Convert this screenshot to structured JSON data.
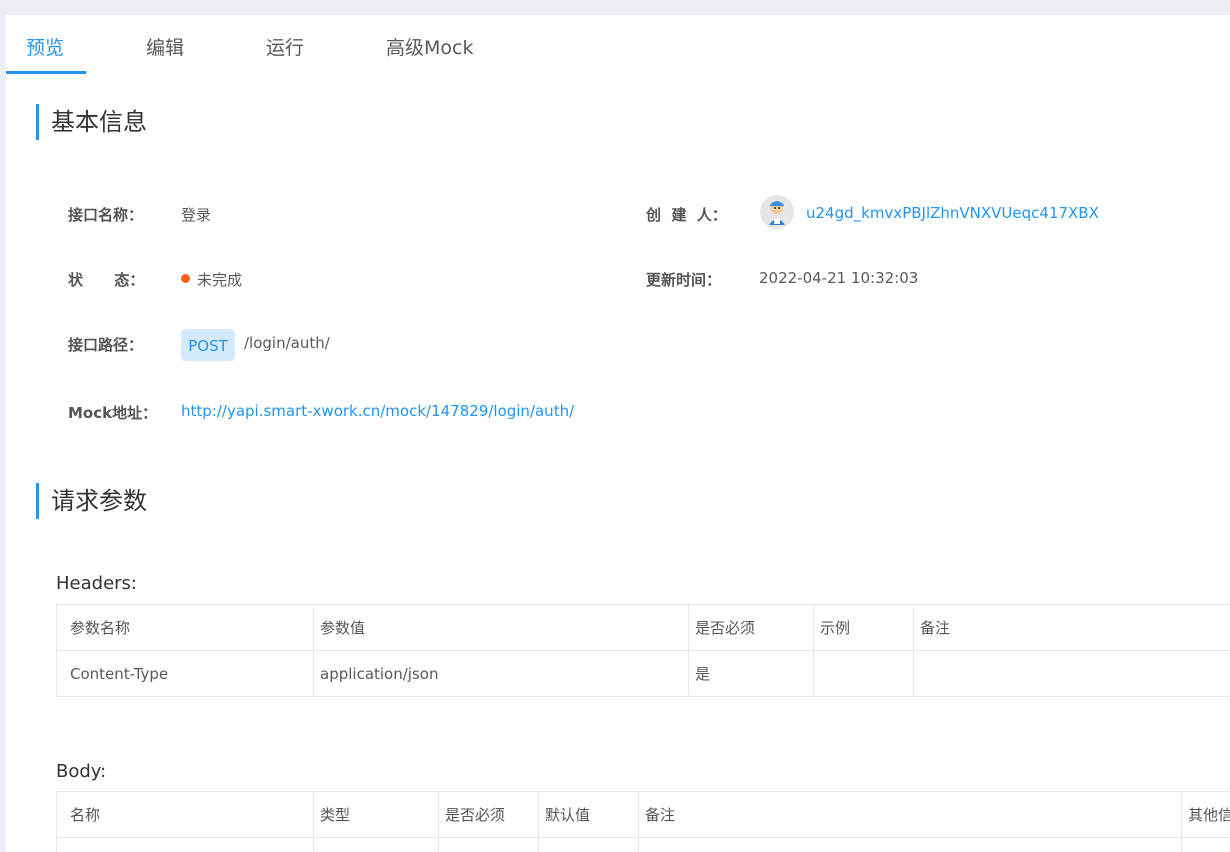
{
  "tabs": [
    {
      "label": "预览",
      "active": true
    },
    {
      "label": "编辑",
      "active": false
    },
    {
      "label": "运行",
      "active": false
    },
    {
      "label": "高级Mock",
      "active": false
    }
  ],
  "basic_info": {
    "title": "基本信息",
    "name_label": "接口名称：",
    "name_value": "登录",
    "creator_label": "创  建  人：",
    "creator_name": "u24gd_kmvxPBJlZhnVNXVUeqc417XBX",
    "status_label": "状      态：",
    "status_value": "未完成",
    "updated_label": "更新时间：",
    "updated_value": "2022-04-21 10:32:03",
    "path_label": "接口路径：",
    "method": "POST",
    "path_value": "/login/auth/",
    "mock_label": "Mock地址：",
    "mock_url": "http://yapi.smart-xwork.cn/mock/147829/login/auth/"
  },
  "colors": {
    "accent": "#2395f1",
    "status_dot": "#fd5d18",
    "badge_bg": "#d2eafb"
  },
  "request": {
    "title": "请求参数",
    "headers_title": "Headers:",
    "headers_columns": [
      "参数名称",
      "参数值",
      "是否必须",
      "示例",
      "备注"
    ],
    "headers_rows": [
      [
        "Content-Type",
        "application/json",
        "是",
        "",
        ""
      ]
    ],
    "body_title": "Body:",
    "body_columns": [
      "名称",
      "类型",
      "是否必须",
      "默认值",
      "备注",
      "其他信息"
    ]
  }
}
